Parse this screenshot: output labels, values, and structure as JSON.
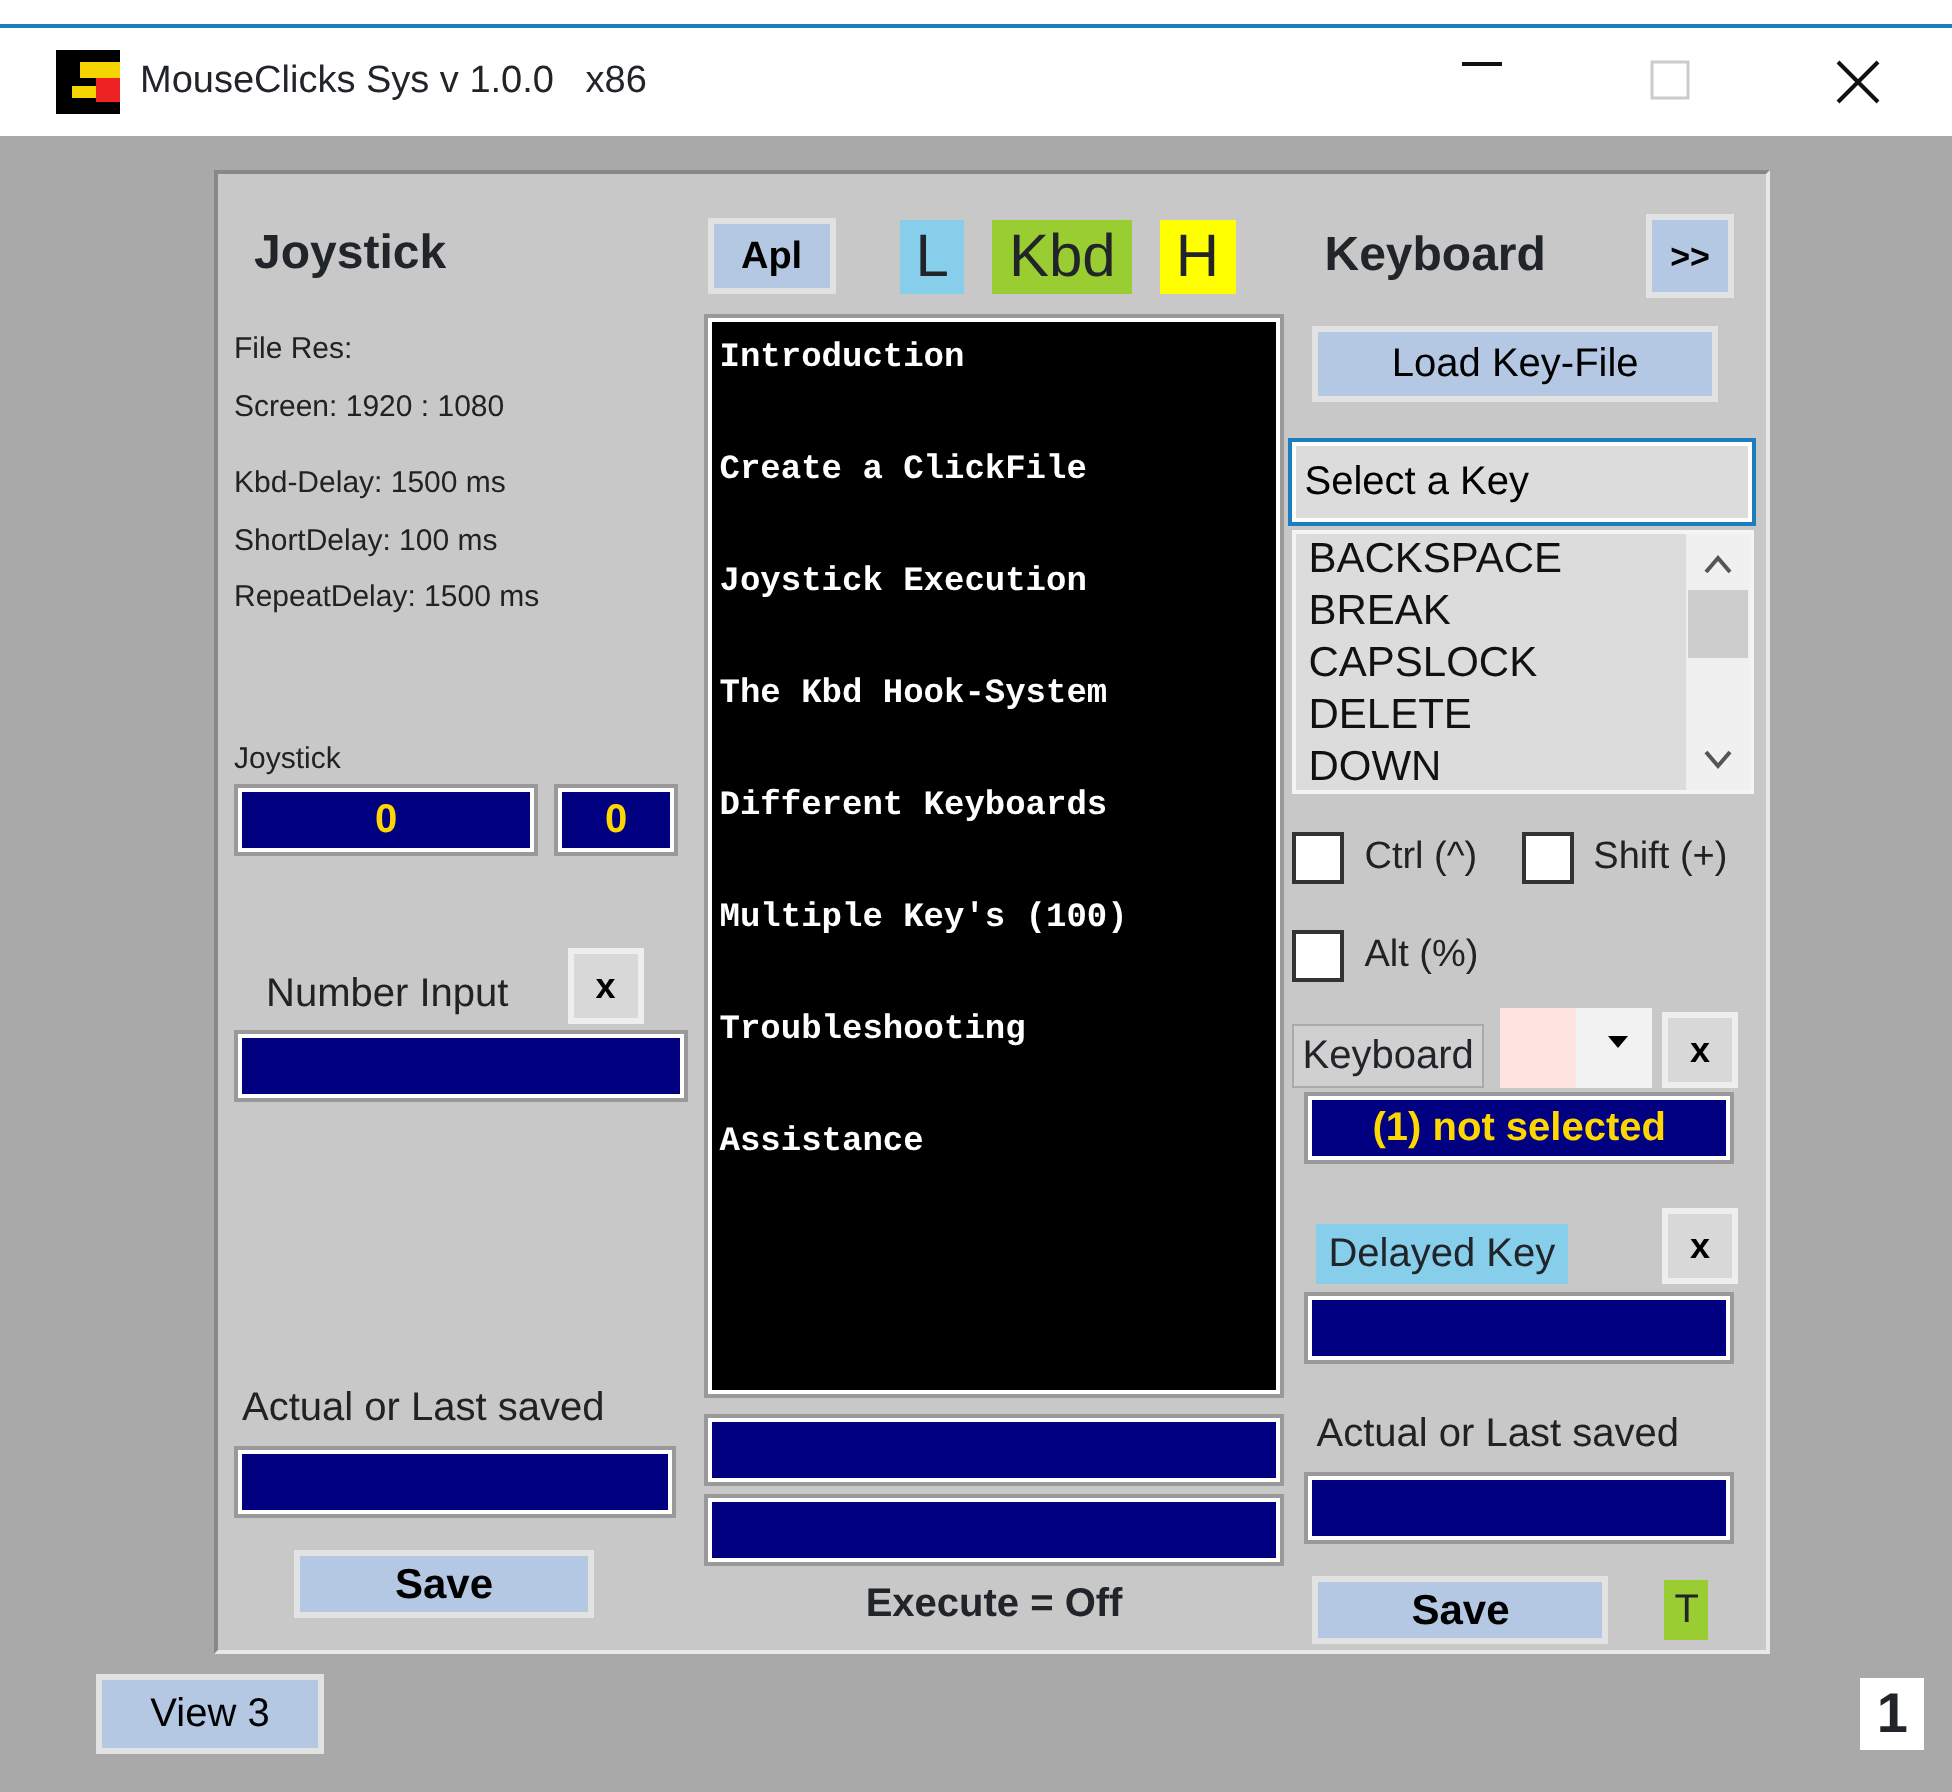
{
  "window": {
    "title": "MouseClicks Sys v 1.0.0   x86"
  },
  "joystick_panel": {
    "heading": "Joystick",
    "info": [
      "File Res:",
      "Screen: 1920 : 1080",
      "Kbd-Delay: 1500 ms",
      "ShortDelay: 100 ms",
      "RepeatDelay: 1500 ms"
    ],
    "joystick_label": "Joystick",
    "joystick_values": [
      "0",
      "0"
    ],
    "number_input_label": "Number Input",
    "clear_button": "x",
    "actual_label": "Actual or Last saved",
    "save_button": "Save"
  },
  "center_panel": {
    "apl_button": "Apl",
    "mode_tags": [
      {
        "label": "L",
        "color": "#87ceeb"
      },
      {
        "label": "Kbd",
        "color": "#9acd32"
      },
      {
        "label": "H",
        "color": "#ffff00"
      }
    ],
    "help_topics": [
      "Introduction",
      "Create a ClickFile",
      "Joystick Execution",
      "The Kbd Hook-System",
      "Different Keyboards",
      "Multiple Key's (100)",
      "Troubleshooting",
      "Assistance"
    ],
    "execute_status": "Execute = Off"
  },
  "keyboard_panel": {
    "heading": "Keyboard",
    "next_button": ">>",
    "load_button": "Load Key-File",
    "key_field": {
      "value": "Select a Key"
    },
    "key_list": [
      "BACKSPACE",
      "BREAK",
      "CAPSLOCK",
      "DELETE",
      "DOWN"
    ],
    "modifiers": [
      {
        "label": "Ctrl (^)",
        "checked": false
      },
      {
        "label": "Shift (+)",
        "checked": false
      },
      {
        "label": "Alt (%)",
        "checked": false
      }
    ],
    "keyboard_label": "Keyboard",
    "keyboard_clear": "x",
    "keyboard_status": "(1) not selected",
    "delayed_key_label": "Delayed Key",
    "delayed_clear": "x",
    "actual_label": "Actual or Last saved",
    "save_button": "Save",
    "t_badge": "T"
  },
  "view_button": "View 3",
  "page_number": "1"
}
